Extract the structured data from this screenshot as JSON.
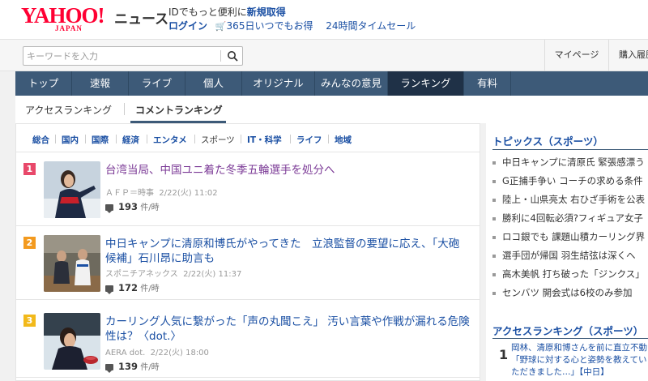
{
  "header": {
    "logo_word": "YAHOO!",
    "logo_sub": "JAPAN",
    "logo_news": "ニュース",
    "promo_line1": "IDでもっと便利に",
    "promo_link": "新規取得",
    "login": "ログイン",
    "promo_365": "365日いつでもお得",
    "promo_sale": "24時間タイムセール"
  },
  "search": {
    "placeholder": "キーワードを入力"
  },
  "toolbar": {
    "mypage": "マイページ",
    "buy": "購入履歴"
  },
  "nav": {
    "items": [
      {
        "label": "トップ"
      },
      {
        "label": "速報"
      },
      {
        "label": "ライブ"
      },
      {
        "label": "個人"
      },
      {
        "label": "オリジナル"
      },
      {
        "label": "みんなの意見"
      },
      {
        "label": "ランキング"
      },
      {
        "label": "有料"
      }
    ]
  },
  "subtabs": {
    "access": "アクセスランキング",
    "comment": "コメントランキング"
  },
  "categories": [
    "総合",
    "国内",
    "国際",
    "経済",
    "エンタメ",
    "スポーツ",
    "IT・科学",
    "ライフ",
    "地域"
  ],
  "articles": [
    {
      "rank": "1",
      "title": "台湾当局、中国ユニ着た冬季五輪選手を処分へ",
      "source": "ＡＦＰ＝時事",
      "date": "2/22(火) 11:02",
      "count": "193",
      "unit": "件/時"
    },
    {
      "rank": "2",
      "title": "中日キャンプに清原和博氏がやってきた　立浪監督の要望に応え、「大砲候補」石川昂に助言も",
      "source": "スポニチアネックス",
      "date": "2/22(火) 11:37",
      "count": "172",
      "unit": "件/時"
    },
    {
      "rank": "3",
      "title": "カーリング人気に繋がった「声の丸聞こえ」 汚い言葉や作戦が漏れる危険性は？〈dot.〉",
      "source": "AERA dot.",
      "date": "2/22(火) 18:00",
      "count": "139",
      "unit": "件/時"
    }
  ],
  "sidebar": {
    "topics_title": "トピックス（スポーツ）",
    "topics": [
      "中日キャンプに清原氏 緊張感漂う",
      "G正捕手争い コーチの求める条件",
      "陸上・山県亮太 右ひざ手術を公表",
      "勝利に4回転必須?フィギュア女子",
      "ロコ銀でも 課題山積カーリング界",
      "選手団が帰国 羽生結弦は深くへ",
      "高木美帆 打ち破った「ジンクス」",
      "センバツ 開会式は6校のみ参加"
    ],
    "access_title": "アクセスランキング（スポーツ）",
    "access_rank": "1",
    "access_text": "岡林、清原和博さんを前に直立不動「野球に対する心と姿勢を教えていただきました…」【中日】"
  },
  "colors": {
    "nav_bg": "#3d5a78",
    "nav_active": "#1f3147",
    "link": "#1a4fa3",
    "visited": "#7b3a96",
    "rank1": "#e8486a",
    "rank2": "#f39a1e",
    "rank3": "#f2b91a"
  }
}
